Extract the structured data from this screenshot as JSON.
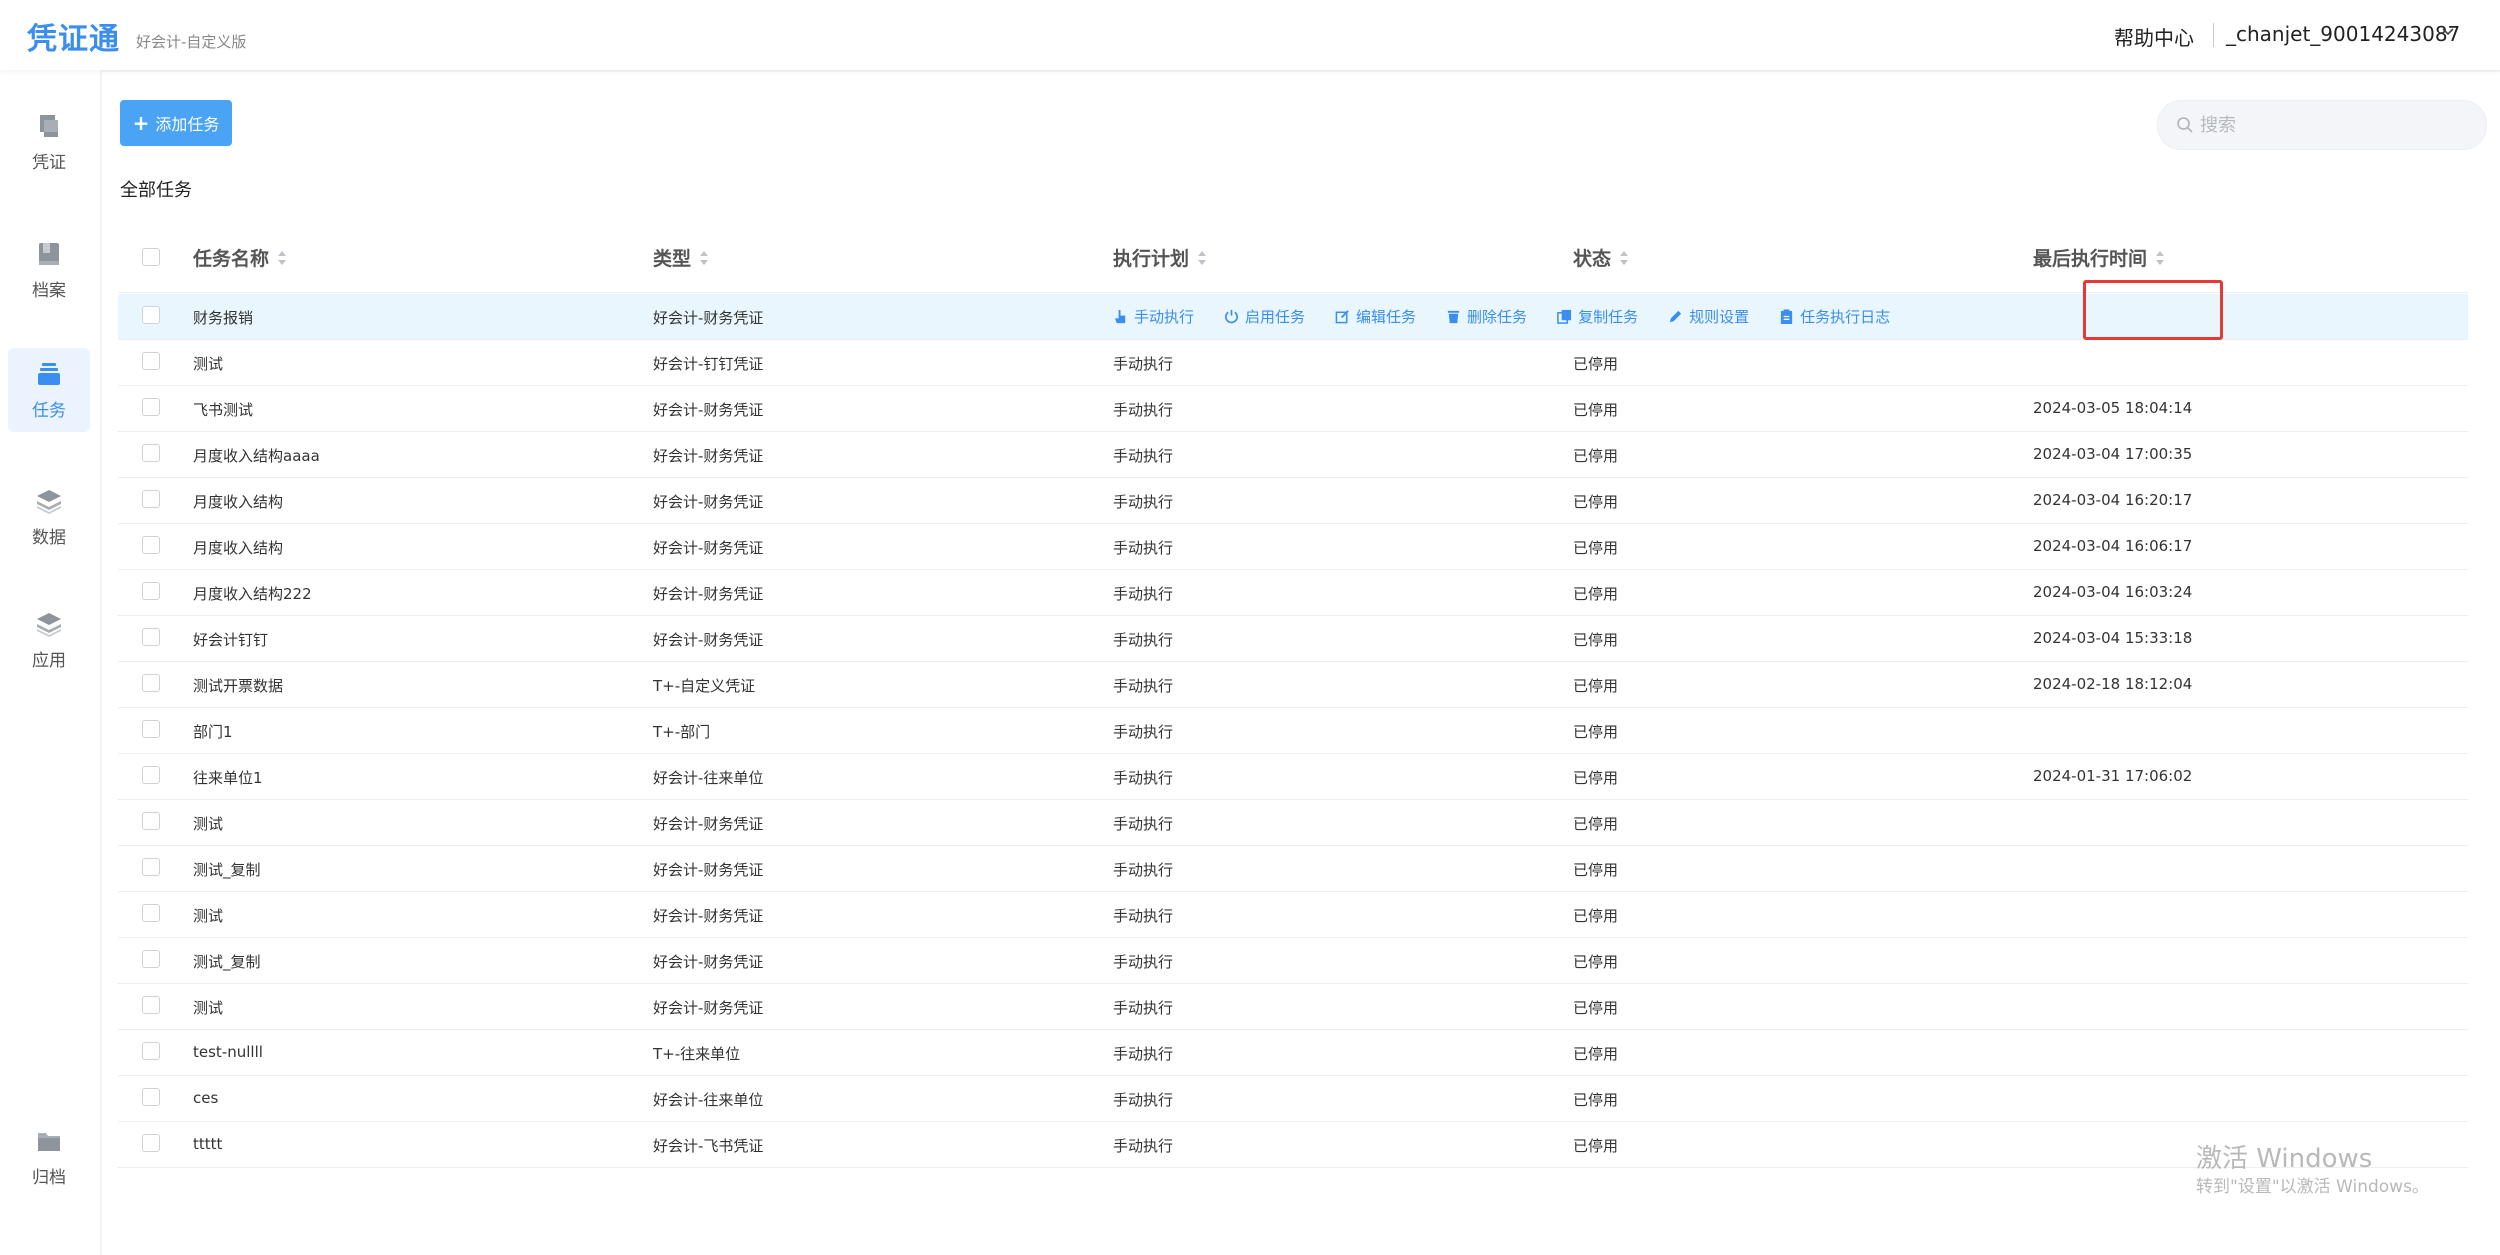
{
  "header": {
    "logo": "凭证通",
    "subtitle": "好会计-自定义版",
    "help": "帮助中心",
    "user": "_chanjet_90014243087"
  },
  "sidebar": {
    "items": [
      {
        "label": "凭证",
        "icon": "voucher-icon"
      },
      {
        "label": "档案",
        "icon": "archive-book-icon"
      },
      {
        "label": "任务",
        "icon": "task-icon",
        "active": true
      },
      {
        "label": "数据",
        "icon": "data-layers-icon"
      },
      {
        "label": "应用",
        "icon": "app-layers-icon"
      },
      {
        "label": "归档",
        "icon": "folder-icon"
      }
    ]
  },
  "toolbar": {
    "add_label": "添加任务",
    "search_placeholder": "搜索"
  },
  "section_title": "全部任务",
  "table": {
    "headers": [
      "任务名称",
      "类型",
      "执行计划",
      "状态",
      "最后执行时间"
    ],
    "actions": [
      "手动执行",
      "启用任务",
      "编辑任务",
      "删除任务",
      "复制任务",
      "规则设置",
      "任务执行日志"
    ],
    "rows": [
      {
        "name": "财务报销",
        "type": "好会计-财务凭证",
        "plan": "",
        "status": "",
        "time": ""
      },
      {
        "name": "测试",
        "type": "好会计-钉钉凭证",
        "plan": "手动执行",
        "status": "已停用",
        "time": ""
      },
      {
        "name": "飞书测试",
        "type": "好会计-财务凭证",
        "plan": "手动执行",
        "status": "已停用",
        "time": "2024-03-05 18:04:14"
      },
      {
        "name": "月度收入结构aaaa",
        "type": "好会计-财务凭证",
        "plan": "手动执行",
        "status": "已停用",
        "time": "2024-03-04 17:00:35"
      },
      {
        "name": "月度收入结构",
        "type": "好会计-财务凭证",
        "plan": "手动执行",
        "status": "已停用",
        "time": "2024-03-04 16:20:17"
      },
      {
        "name": "月度收入结构",
        "type": "好会计-财务凭证",
        "plan": "手动执行",
        "status": "已停用",
        "time": "2024-03-04 16:06:17"
      },
      {
        "name": "月度收入结构222",
        "type": "好会计-财务凭证",
        "plan": "手动执行",
        "status": "已停用",
        "time": "2024-03-04 16:03:24"
      },
      {
        "name": "好会计钉钉",
        "type": "好会计-财务凭证",
        "plan": "手动执行",
        "status": "已停用",
        "time": "2024-03-04 15:33:18"
      },
      {
        "name": "测试开票数据",
        "type": "T+-自定义凭证",
        "plan": "手动执行",
        "status": "已停用",
        "time": "2024-02-18 18:12:04"
      },
      {
        "name": "部门1",
        "type": "T+-部门",
        "plan": "手动执行",
        "status": "已停用",
        "time": ""
      },
      {
        "name": "往来单位1",
        "type": "好会计-往来单位",
        "plan": "手动执行",
        "status": "已停用",
        "time": "2024-01-31 17:06:02"
      },
      {
        "name": "测试",
        "type": "好会计-财务凭证",
        "plan": "手动执行",
        "status": "已停用",
        "time": ""
      },
      {
        "name": "测试_复制",
        "type": "好会计-财务凭证",
        "plan": "手动执行",
        "status": "已停用",
        "time": ""
      },
      {
        "name": "测试",
        "type": "好会计-财务凭证",
        "plan": "手动执行",
        "status": "已停用",
        "time": ""
      },
      {
        "name": "测试_复制",
        "type": "好会计-财务凭证",
        "plan": "手动执行",
        "status": "已停用",
        "time": ""
      },
      {
        "name": "测试",
        "type": "好会计-财务凭证",
        "plan": "手动执行",
        "status": "已停用",
        "time": ""
      },
      {
        "name": "test-nullll",
        "type": "T+-往来单位",
        "plan": "手动执行",
        "status": "已停用",
        "time": ""
      },
      {
        "name": "ces",
        "type": "好会计-往来单位",
        "plan": "手动执行",
        "status": "已停用",
        "time": ""
      },
      {
        "name": "ttttt",
        "type": "好会计-飞书凭证",
        "plan": "手动执行",
        "status": "已停用",
        "time": ""
      }
    ]
  },
  "watermark": {
    "line1": "激活 Windows",
    "line2": "转到\"设置\"以激活 Windows。"
  },
  "colors": {
    "accent": "#3a8ef0",
    "button": "#4aa3f5",
    "highlight_row": "#e9f6fd",
    "annotation_box": "#e53935"
  }
}
